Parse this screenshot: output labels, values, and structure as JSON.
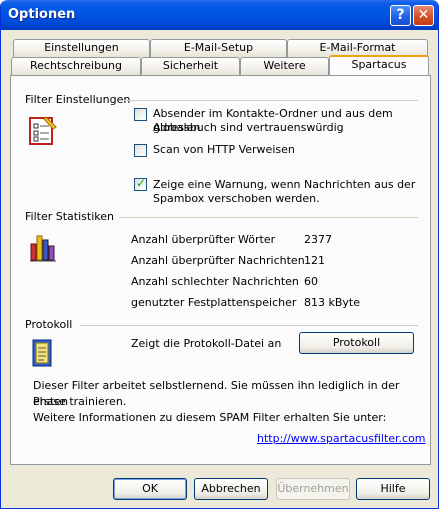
{
  "window": {
    "title": "Optionen"
  },
  "tabs_row1": [
    {
      "label": "Einstellungen"
    },
    {
      "label": "E-Mail-Setup"
    },
    {
      "label": "E-Mail-Format"
    }
  ],
  "tabs_row2": [
    {
      "label": "Rechtschreibung"
    },
    {
      "label": "Sicherheit"
    },
    {
      "label": "Weitere"
    },
    {
      "label": "Spartacus",
      "active": true
    }
  ],
  "filter_settings": {
    "heading": "Filter Einstellungen",
    "options": [
      {
        "label_line1": "Absender im Kontakte-Ordner und aus dem globalen",
        "label_line2": "Adressbuch sind vertrauenswürdig",
        "checked": false
      },
      {
        "label_line1": "Scan von HTTP Verweisen",
        "label_line2": "",
        "checked": false
      },
      {
        "label_line1": "Zeige eine Warnung, wenn Nachrichten aus der",
        "label_line2": "Spambox verschoben werden.",
        "checked": true
      }
    ]
  },
  "filter_stats": {
    "heading": "Filter Statistiken",
    "rows": [
      {
        "label": "Anzahl überprüfter Wörter",
        "value": "2377"
      },
      {
        "label": "Anzahl überprüfter Nachrichten",
        "value": "121"
      },
      {
        "label": "Anzahl schlechter Nachrichten",
        "value": "60"
      },
      {
        "label": "genutzter Festplattenspeicher",
        "value": "813 kByte"
      }
    ]
  },
  "protocol": {
    "heading": "Protokoll",
    "description": "Zeigt die Protokoll-Datei an",
    "button": "Protokoll"
  },
  "info": {
    "line1": "Dieser Filter arbeitet selbstlernend. Sie müssen ihn lediglich in der ersten",
    "line2": "Phase trainieren.",
    "line3": "Weitere Informationen zu diesem SPAM Filter erhalten Sie unter:",
    "link": "http://www.spartacusfilter.com"
  },
  "buttons": {
    "ok": "OK",
    "cancel": "Abbrechen",
    "apply": "Übernehmen",
    "help": "Hilfe"
  },
  "colors": {
    "titlebar": "#0055e5",
    "window_bg": "#ece9d8",
    "active_tab_accent": "#f0a014",
    "link": "#0000ff"
  }
}
